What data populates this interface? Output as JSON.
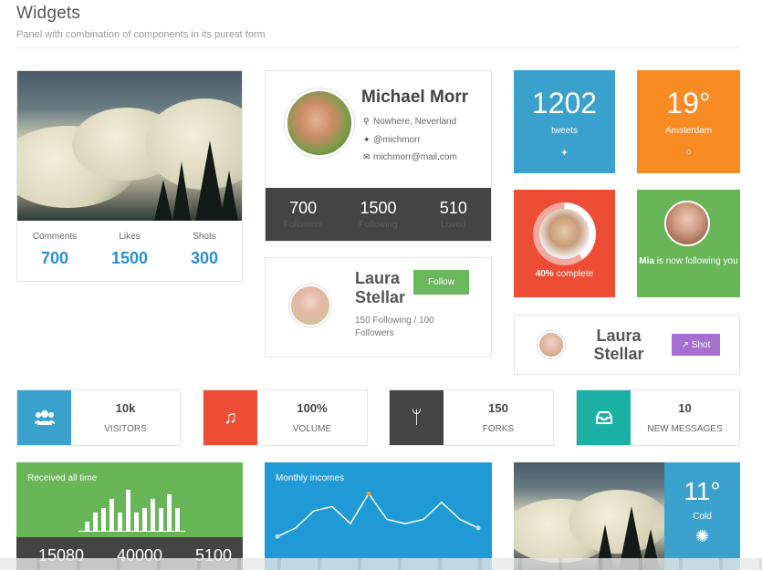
{
  "header": {
    "title": "Widgets",
    "subtitle": "Panel with combination of components in its purest form"
  },
  "photo_card": {
    "stats": [
      {
        "label": "Comments",
        "value": "700"
      },
      {
        "label": "Likes",
        "value": "1500"
      },
      {
        "label": "Shots",
        "value": "300"
      }
    ]
  },
  "profile": {
    "name": "Michael Morr",
    "location": "Nowhere, Neverland",
    "twitter": "@michmorr",
    "email": "michmorr@mail.com",
    "stats": [
      {
        "value": "700",
        "label": "Followers"
      },
      {
        "value": "1500",
        "label": "Following"
      },
      {
        "value": "510",
        "label": "Loved"
      }
    ]
  },
  "laura_card": {
    "name": "Laura Stellar",
    "follow_label": "Follow",
    "subtitle": "150 Following / 100 Followers"
  },
  "tweets_tile": {
    "count": "1202",
    "label": "tweets",
    "icon": "twitter-icon",
    "color": "#3aa0cc"
  },
  "weather_tile": {
    "temp": "19°",
    "city": "Amsterdam",
    "icon": "sun-icon",
    "color": "#f68a23"
  },
  "progress_tile": {
    "percent_text": "40%",
    "suffix": " complete",
    "progress": 0.4,
    "color": "#ec4d34"
  },
  "mia_tile": {
    "name": "Mia",
    "text": " is now following you",
    "color": "#68b557"
  },
  "shot_card": {
    "name": "Laura Stellar",
    "shot_label": "Shot",
    "shot_color": "#a76fd0"
  },
  "stat_row": [
    {
      "icon": "users-icon",
      "value": "10k",
      "label": "VISITORS",
      "color": "#3aa0cc"
    },
    {
      "icon": "music-icon",
      "value": "100%",
      "label": "VOLUME",
      "color": "#ec4d34"
    },
    {
      "icon": "fork-icon",
      "value": "150",
      "label": "FORKS",
      "color": "#444444"
    },
    {
      "icon": "inbox-icon",
      "value": "10",
      "label": "NEW MESSAGES",
      "color": "#1ab0a3"
    }
  ],
  "received_chart": {
    "title": "Received all time",
    "foot_values": [
      "15080",
      "40000",
      "5100"
    ]
  },
  "monthly_chart": {
    "title": "Monthly incomes"
  },
  "weather_small": {
    "temp": "11°",
    "condition": "Cold",
    "icon": "sun-icon"
  },
  "chart_data": [
    {
      "type": "bar",
      "title": "Received all time",
      "values": [
        2,
        4,
        5,
        7,
        4,
        9,
        4,
        5,
        7,
        5,
        8,
        5
      ]
    },
    {
      "type": "line",
      "title": "Monthly incomes",
      "values": [
        2,
        3,
        5,
        5.5,
        3.5,
        7,
        4,
        3.5,
        4,
        6,
        4,
        3
      ]
    }
  ]
}
